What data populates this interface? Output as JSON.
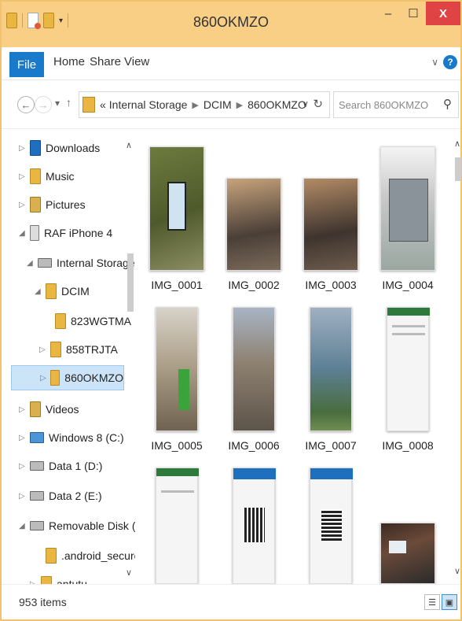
{
  "window": {
    "title": "860OKMZO",
    "minimize_glyph": "–",
    "maximize_glyph": "☐",
    "close_glyph": "X"
  },
  "ribbon": {
    "file": "File",
    "home": "Home",
    "share": "Share",
    "view": "View",
    "expand_glyph": "∨",
    "help_glyph": "?"
  },
  "nav": {
    "breadcrumb_prefix": "«",
    "breadcrumb": [
      "Internal Storage",
      "DCIM",
      "860OKMZO"
    ],
    "search_placeholder": "Search 860OKMZO"
  },
  "sidebar": {
    "items": [
      {
        "label": "Downloads",
        "icon": "downloads-folder-icon"
      },
      {
        "label": "Music",
        "icon": "music-folder-icon"
      },
      {
        "label": "Pictures",
        "icon": "pictures-folder-icon"
      },
      {
        "label": "RAF iPhone 4",
        "icon": "phone-icon"
      },
      {
        "label": "Internal Storage",
        "icon": "drive-icon"
      },
      {
        "label": "DCIM",
        "icon": "folder-icon"
      },
      {
        "label": "823WGTMA",
        "icon": "folder-icon"
      },
      {
        "label": "858TRJTA",
        "icon": "folder-icon"
      },
      {
        "label": "860OKMZO",
        "icon": "folder-icon",
        "selected": true
      },
      {
        "label": "Videos",
        "icon": "videos-folder-icon"
      },
      {
        "label": "Windows 8 (C:)",
        "icon": "windows-drive-icon"
      },
      {
        "label": "Data 1 (D:)",
        "icon": "drive-icon"
      },
      {
        "label": "Data 2 (E:)",
        "icon": "drive-icon"
      },
      {
        "label": "Removable Disk (F:)",
        "icon": "drive-icon"
      },
      {
        "label": ".android_secure",
        "icon": "folder-icon"
      },
      {
        "label": "antutu",
        "icon": "folder-icon"
      }
    ]
  },
  "files": [
    {
      "name": "IMG_0001"
    },
    {
      "name": "IMG_0002"
    },
    {
      "name": "IMG_0003"
    },
    {
      "name": "IMG_0004"
    },
    {
      "name": "IMG_0005"
    },
    {
      "name": "IMG_0006"
    },
    {
      "name": "IMG_0007"
    },
    {
      "name": "IMG_0008"
    }
  ],
  "status": {
    "item_count": "953 items"
  },
  "colors": {
    "title_bar": "#f9cf86",
    "accent": "#1979ca",
    "close": "#e04343",
    "selection": "#cce4f7"
  }
}
